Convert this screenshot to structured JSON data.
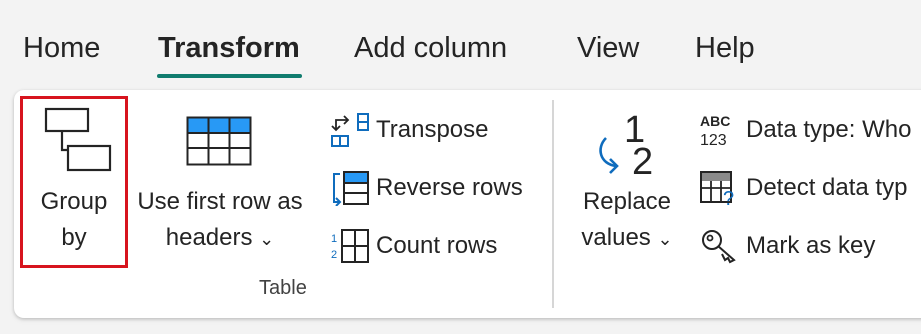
{
  "tabs": [
    {
      "label": "Home"
    },
    {
      "label": "Transform",
      "active": true
    },
    {
      "label": "Add column"
    },
    {
      "label": "View"
    },
    {
      "label": "Help"
    }
  ],
  "ribbon": {
    "group_by": {
      "line1": "Group",
      "line2": "by"
    },
    "use_first_row": {
      "line1": "Use first row as",
      "line2": "headers",
      "chevron": "⌄"
    },
    "transpose": {
      "label": "Transpose"
    },
    "reverse_rows": {
      "label": "Reverse rows"
    },
    "count_rows": {
      "label": "Count rows"
    },
    "table_group_label": "Table",
    "replace_values": {
      "line1": "Replace",
      "line2": "values",
      "chevron": "⌄"
    },
    "data_type": {
      "label": "Data type: Who",
      "icon_text_top": "ABC",
      "icon_text_bottom": "123"
    },
    "detect_data_type": {
      "label": "Detect data typ"
    },
    "mark_as_key": {
      "label": "Mark as key"
    },
    "replace_icon_text": {
      "one": "1",
      "two": "2"
    }
  },
  "colors": {
    "accent": "#107c6e",
    "icon_blue": "#0f6cbd",
    "highlight_red": "#d7141e"
  }
}
